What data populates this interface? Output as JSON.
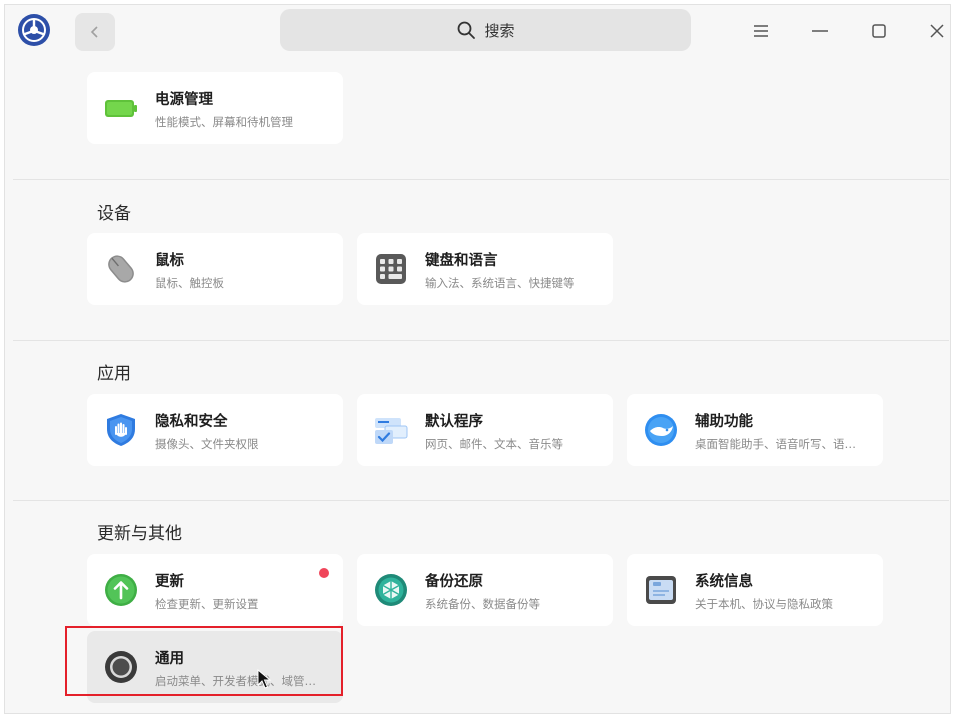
{
  "titlebar": {
    "search_placeholder": "搜索"
  },
  "top_card": {
    "title": "电源管理",
    "desc": "性能模式、屏幕和待机管理"
  },
  "sections": [
    {
      "title": "设备",
      "cards": [
        {
          "title": "鼠标",
          "desc": "鼠标、触控板",
          "icon": "mouse-icon"
        },
        {
          "title": "键盘和语言",
          "desc": "输入法、系统语言、快捷键等",
          "icon": "keyboard-icon"
        }
      ]
    },
    {
      "title": "应用",
      "cards": [
        {
          "title": "隐私和安全",
          "desc": "摄像头、文件夹权限",
          "icon": "shield-icon"
        },
        {
          "title": "默认程序",
          "desc": "网页、邮件、文本、音乐等",
          "icon": "default-apps-icon"
        },
        {
          "title": "辅助功能",
          "desc": "桌面智能助手、语音听写、语…",
          "icon": "accessibility-icon"
        }
      ]
    },
    {
      "title": "更新与其他",
      "cards": [
        {
          "title": "更新",
          "desc": "检查更新、更新设置",
          "icon": "update-icon"
        },
        {
          "title": "备份还原",
          "desc": "系统备份、数据备份等",
          "icon": "backup-icon"
        },
        {
          "title": "系统信息",
          "desc": "关于本机、协议与隐私政策",
          "icon": "system-info-icon"
        },
        {
          "title": "通用",
          "desc": "启动菜单、开发者模式、域管…",
          "icon": "general-icon"
        }
      ]
    }
  ],
  "colors": {
    "accent": "#3a7fe8",
    "highlight": "#e4202a",
    "badge": "#f0455a"
  }
}
